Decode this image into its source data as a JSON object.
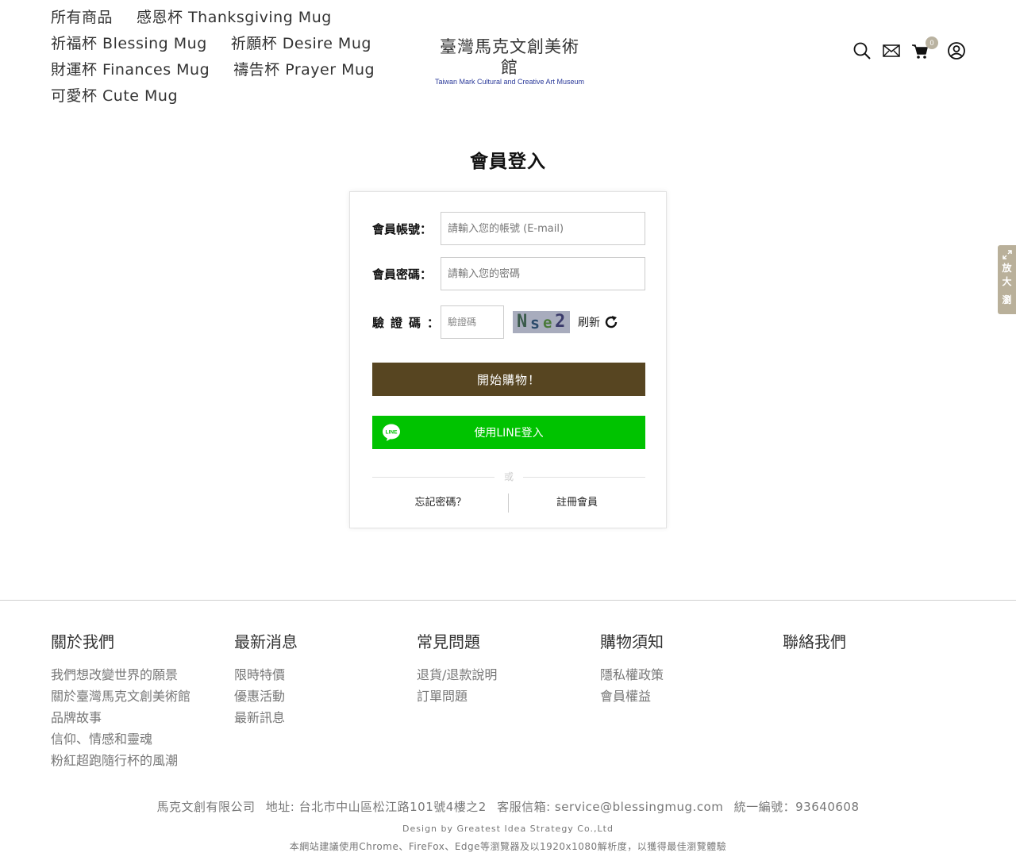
{
  "header": {
    "nav": [
      [
        "所有商品",
        "感恩杯 Thanksgiving Mug"
      ],
      [
        "祈福杯 Blessing Mug",
        "祈願杯 Desire Mug"
      ],
      [
        "財運杯 Finances Mug",
        "禱告杯 Prayer Mug"
      ],
      [
        "可愛杯 Cute Mug"
      ]
    ],
    "logo_cn": "臺灣馬克文創美術館",
    "logo_en": "Taiwan Mark Cultural and Creative Art Museum",
    "cart_count": "0",
    "icons": [
      "search-icon",
      "mail-icon",
      "cart-icon",
      "user-icon"
    ]
  },
  "login": {
    "title": "會員登入",
    "account_label": "會員帳號：",
    "account_placeholder": "請輸入您的帳號 (E-mail)",
    "password_label": "會員密碼：",
    "password_placeholder": "請輸入您的密碼",
    "captcha_label": "驗證碼：",
    "captcha_placeholder": "驗證碼",
    "captcha_text": [
      "N",
      "s",
      "e",
      "2"
    ],
    "refresh_label": "刷新",
    "submit_label": "開始購物！",
    "line_label": "使用LINE登入",
    "line_logo_text": "LINE",
    "or_text": "或",
    "forgot_label": "忘記密碼？",
    "register_label": "註冊會員"
  },
  "zoom_tab": {
    "label": [
      "放",
      "大",
      "瀏"
    ]
  },
  "footer": {
    "columns": [
      {
        "title": "關於我們",
        "links": [
          "我們想改變世界的願景",
          "關於臺灣馬克文創美術館",
          "品牌故事",
          "信仰、情感和靈魂",
          "粉紅超跑隨行杯的風潮"
        ]
      },
      {
        "title": "最新消息",
        "links": [
          "限時特價",
          "優惠活動",
          "最新訊息"
        ]
      },
      {
        "title": "常見問題",
        "links": [
          "退貨/退款說明",
          "訂單問題"
        ]
      },
      {
        "title": "購物須知",
        "links": [
          "隱私權政策",
          "會員權益"
        ]
      },
      {
        "title": "聯絡我們",
        "links": []
      }
    ],
    "company": "馬克文創有限公司",
    "address": "地址: 台北市中山區松江路101號4樓之2",
    "email": "客服信箱: service@blessingmug.com",
    "tax_id": "統一編號：93640608",
    "design": "Design by Greatest Idea Strategy Co.,Ltd",
    "browser_note": "本網站建議使用Chrome、FireFox、Edge等瀏覽器及以1920x1080解析度，以獲得最佳瀏覽體驗"
  }
}
